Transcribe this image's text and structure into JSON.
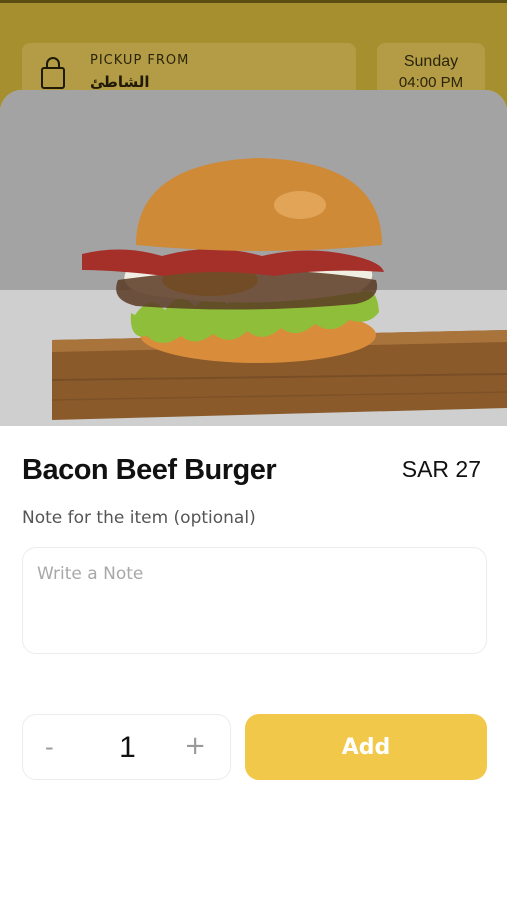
{
  "header": {
    "pickup_label": "PICKUP FROM",
    "pickup_location": "الشاطئ",
    "day": "Sunday",
    "time": "04:00 PM"
  },
  "item": {
    "name": "Bacon Beef Burger",
    "price": "SAR 27",
    "image": "burger-photo"
  },
  "note": {
    "label": "Note for the item (optional)",
    "placeholder": "Write a Note",
    "value": ""
  },
  "order": {
    "minus_label": "-",
    "quantity": "1",
    "plus_label": "+",
    "add_label": "Add"
  },
  "colors": {
    "header_bg": "#a68f2e",
    "accent": "#f2c84b",
    "text": "#111111"
  }
}
